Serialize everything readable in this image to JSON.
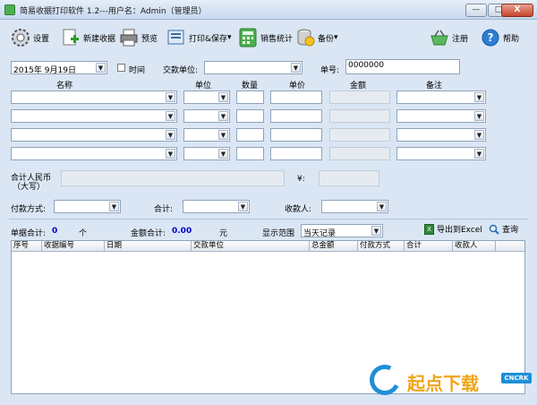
{
  "window": {
    "title": "简易收据打印软件 1.2---用户名：Admin（管理员）",
    "min": "—",
    "max": "□",
    "close": "X"
  },
  "toolbar": {
    "settings": "设置",
    "new_receipt": "新建收据",
    "preview": "预览",
    "print_save": "打印&保存",
    "stats": "销售统计",
    "backup": "备份",
    "register": "注册",
    "help": "帮助"
  },
  "form": {
    "date_value": "2015年  9月19日",
    "time_label": "时间",
    "payer_label": "交款单位:",
    "number_label": "单号:",
    "number_value": "0000000",
    "col_name": "名称",
    "col_unit": "单位",
    "col_qty": "数量",
    "col_price": "单价",
    "col_amount": "金额",
    "col_note": "备注",
    "total_rmb_label": "合计人民币",
    "total_rmb_sub": "（大写）",
    "yen_label": "¥:",
    "payment_method_label": "付款方式:",
    "total_label": "合计:",
    "payee_label": "收款人:"
  },
  "summary": {
    "count_label": "单据合计:",
    "count_value": "0",
    "count_unit": "个",
    "amount_label": "金额合计:",
    "amount_value": "0.00",
    "amount_unit": "元",
    "range_label": "显示范围",
    "range_value": "当天记录",
    "export_label": "导出到Excel",
    "search_label": "查询"
  },
  "grid": {
    "columns": [
      "序号",
      "收据编号",
      "日期",
      "交款单位",
      "总金额",
      "付款方式",
      "合计",
      "收款人"
    ]
  },
  "watermark": {
    "text": "起点下载",
    "badge": "CNCRK"
  },
  "colors": {
    "background": "#dbe6f4",
    "accent_blue": "#0000cc",
    "watermark_orange": "#f0a51a",
    "watermark_blue": "#1f8fd8"
  }
}
